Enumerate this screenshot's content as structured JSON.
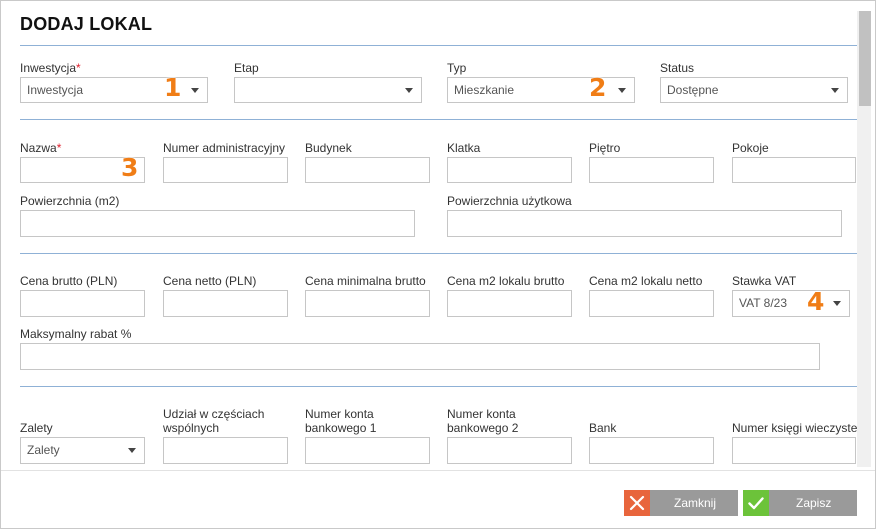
{
  "title": "DODAJ LOKAL",
  "required_mark": "*",
  "row1": {
    "inwestycja": {
      "label": "Inwestycja",
      "value": "Inwestycja"
    },
    "etap": {
      "label": "Etap",
      "value": ""
    },
    "typ": {
      "label": "Typ",
      "value": "Mieszkanie"
    },
    "status": {
      "label": "Status",
      "value": "Dostępne"
    }
  },
  "row2": {
    "nazwa": "Nazwa",
    "numer_admin": "Numer administracyjny",
    "budynek": "Budynek",
    "klatka": "Klatka",
    "pietro": "Piętro",
    "pokoje": "Pokoje",
    "powierzchnia": "Powierzchnia (m2)",
    "powierzchnia_uzytkowa": "Powierzchnia użytkowa"
  },
  "row3": {
    "cena_brutto": "Cena brutto (PLN)",
    "cena_netto": "Cena netto (PLN)",
    "cena_min_brutto": "Cena minimalna brutto",
    "cena_m2_brutto": "Cena m2 lokalu brutto",
    "cena_m2_netto": "Cena m2 lokalu netto",
    "stawka_vat": {
      "label": "Stawka VAT",
      "value": "VAT 8/23"
    },
    "rabat": "Maksymalny rabat %"
  },
  "row4": {
    "zalety": {
      "label": "Zalety",
      "value": "Zalety"
    },
    "udzial_line1": "Udział w częściach",
    "udzial_line2": "wspólnych",
    "konto1_line1": "Numer konta",
    "konto1_line2": "bankowego 1",
    "konto2_line1": "Numer konta",
    "konto2_line2": "bankowego 2",
    "bank": "Bank",
    "ksiega": "Numer księgi wieczystej"
  },
  "badges": [
    "1",
    "2",
    "3",
    "4"
  ],
  "buttons": {
    "close": "Zamknij",
    "save": "Zapisz"
  },
  "colors": {
    "accent_line": "#8fb1d6",
    "badge": "#f07d16",
    "close_btn": "#9a9a9a",
    "close_icon_bg": "#e8653c",
    "save_btn": "#9a9a9a",
    "save_icon_bg": "#6cc33a",
    "required": "#e0202e"
  },
  "icons": {
    "close": "close-icon",
    "save": "checkmark-icon",
    "dropdown": "chevron-down-icon"
  }
}
